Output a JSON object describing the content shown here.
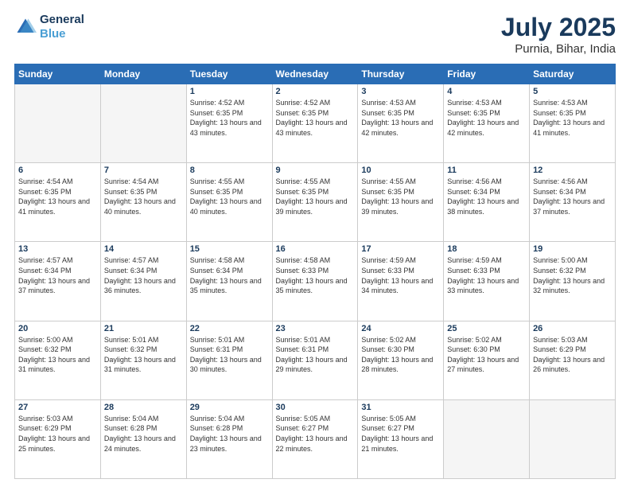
{
  "header": {
    "logo_line1": "General",
    "logo_line2": "Blue",
    "title": "July 2025",
    "subtitle": "Purnia, Bihar, India"
  },
  "weekdays": [
    "Sunday",
    "Monday",
    "Tuesday",
    "Wednesday",
    "Thursday",
    "Friday",
    "Saturday"
  ],
  "weeks": [
    [
      {
        "day": "",
        "info": ""
      },
      {
        "day": "",
        "info": ""
      },
      {
        "day": "1",
        "info": "Sunrise: 4:52 AM\nSunset: 6:35 PM\nDaylight: 13 hours and 43 minutes."
      },
      {
        "day": "2",
        "info": "Sunrise: 4:52 AM\nSunset: 6:35 PM\nDaylight: 13 hours and 43 minutes."
      },
      {
        "day": "3",
        "info": "Sunrise: 4:53 AM\nSunset: 6:35 PM\nDaylight: 13 hours and 42 minutes."
      },
      {
        "day": "4",
        "info": "Sunrise: 4:53 AM\nSunset: 6:35 PM\nDaylight: 13 hours and 42 minutes."
      },
      {
        "day": "5",
        "info": "Sunrise: 4:53 AM\nSunset: 6:35 PM\nDaylight: 13 hours and 41 minutes."
      }
    ],
    [
      {
        "day": "6",
        "info": "Sunrise: 4:54 AM\nSunset: 6:35 PM\nDaylight: 13 hours and 41 minutes."
      },
      {
        "day": "7",
        "info": "Sunrise: 4:54 AM\nSunset: 6:35 PM\nDaylight: 13 hours and 40 minutes."
      },
      {
        "day": "8",
        "info": "Sunrise: 4:55 AM\nSunset: 6:35 PM\nDaylight: 13 hours and 40 minutes."
      },
      {
        "day": "9",
        "info": "Sunrise: 4:55 AM\nSunset: 6:35 PM\nDaylight: 13 hours and 39 minutes."
      },
      {
        "day": "10",
        "info": "Sunrise: 4:55 AM\nSunset: 6:35 PM\nDaylight: 13 hours and 39 minutes."
      },
      {
        "day": "11",
        "info": "Sunrise: 4:56 AM\nSunset: 6:34 PM\nDaylight: 13 hours and 38 minutes."
      },
      {
        "day": "12",
        "info": "Sunrise: 4:56 AM\nSunset: 6:34 PM\nDaylight: 13 hours and 37 minutes."
      }
    ],
    [
      {
        "day": "13",
        "info": "Sunrise: 4:57 AM\nSunset: 6:34 PM\nDaylight: 13 hours and 37 minutes."
      },
      {
        "day": "14",
        "info": "Sunrise: 4:57 AM\nSunset: 6:34 PM\nDaylight: 13 hours and 36 minutes."
      },
      {
        "day": "15",
        "info": "Sunrise: 4:58 AM\nSunset: 6:34 PM\nDaylight: 13 hours and 35 minutes."
      },
      {
        "day": "16",
        "info": "Sunrise: 4:58 AM\nSunset: 6:33 PM\nDaylight: 13 hours and 35 minutes."
      },
      {
        "day": "17",
        "info": "Sunrise: 4:59 AM\nSunset: 6:33 PM\nDaylight: 13 hours and 34 minutes."
      },
      {
        "day": "18",
        "info": "Sunrise: 4:59 AM\nSunset: 6:33 PM\nDaylight: 13 hours and 33 minutes."
      },
      {
        "day": "19",
        "info": "Sunrise: 5:00 AM\nSunset: 6:32 PM\nDaylight: 13 hours and 32 minutes."
      }
    ],
    [
      {
        "day": "20",
        "info": "Sunrise: 5:00 AM\nSunset: 6:32 PM\nDaylight: 13 hours and 31 minutes."
      },
      {
        "day": "21",
        "info": "Sunrise: 5:01 AM\nSunset: 6:32 PM\nDaylight: 13 hours and 31 minutes."
      },
      {
        "day": "22",
        "info": "Sunrise: 5:01 AM\nSunset: 6:31 PM\nDaylight: 13 hours and 30 minutes."
      },
      {
        "day": "23",
        "info": "Sunrise: 5:01 AM\nSunset: 6:31 PM\nDaylight: 13 hours and 29 minutes."
      },
      {
        "day": "24",
        "info": "Sunrise: 5:02 AM\nSunset: 6:30 PM\nDaylight: 13 hours and 28 minutes."
      },
      {
        "day": "25",
        "info": "Sunrise: 5:02 AM\nSunset: 6:30 PM\nDaylight: 13 hours and 27 minutes."
      },
      {
        "day": "26",
        "info": "Sunrise: 5:03 AM\nSunset: 6:29 PM\nDaylight: 13 hours and 26 minutes."
      }
    ],
    [
      {
        "day": "27",
        "info": "Sunrise: 5:03 AM\nSunset: 6:29 PM\nDaylight: 13 hours and 25 minutes."
      },
      {
        "day": "28",
        "info": "Sunrise: 5:04 AM\nSunset: 6:28 PM\nDaylight: 13 hours and 24 minutes."
      },
      {
        "day": "29",
        "info": "Sunrise: 5:04 AM\nSunset: 6:28 PM\nDaylight: 13 hours and 23 minutes."
      },
      {
        "day": "30",
        "info": "Sunrise: 5:05 AM\nSunset: 6:27 PM\nDaylight: 13 hours and 22 minutes."
      },
      {
        "day": "31",
        "info": "Sunrise: 5:05 AM\nSunset: 6:27 PM\nDaylight: 13 hours and 21 minutes."
      },
      {
        "day": "",
        "info": ""
      },
      {
        "day": "",
        "info": ""
      }
    ]
  ]
}
